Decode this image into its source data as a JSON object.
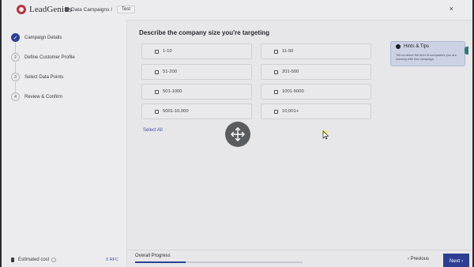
{
  "app": {
    "logo_text": "LeadGenius"
  },
  "breadcrumb": {
    "section": "Data Campaigns /",
    "current": "Test"
  },
  "close_label": "×",
  "steps": [
    {
      "number": "✓",
      "label": "Campaign Details",
      "status": "done"
    },
    {
      "number": "2",
      "label": "Define Customer Profile",
      "status": "pending"
    },
    {
      "number": "3",
      "label": "Select Data Points",
      "status": "pending"
    },
    {
      "number": "4",
      "label": "Review & Confirm",
      "status": "pending"
    }
  ],
  "estimated_cost": {
    "label": "Estimated cost",
    "value": "0 RFC"
  },
  "main": {
    "heading": "Describe the company size you're targeting",
    "options": [
      {
        "label": "1-10",
        "checked": false
      },
      {
        "label": "11-50",
        "checked": false
      },
      {
        "label": "51-200",
        "checked": false
      },
      {
        "label": "201-500",
        "checked": false
      },
      {
        "label": "501-1000",
        "checked": false
      },
      {
        "label": "1001-5000",
        "checked": false
      },
      {
        "label": "5001-10,000",
        "checked": false
      },
      {
        "label": "10,001+",
        "checked": false
      }
    ],
    "select_all": "Select All"
  },
  "tips": {
    "title": "Hints & Tips",
    "body": "Tell us about the kind of companies you are working with this campaign."
  },
  "bottom": {
    "progress_label": "Overall Progress",
    "progress": 0.3,
    "prev_label": "‹  Previous",
    "next_label": "Next  ›"
  },
  "colors": {
    "accent": "#2d3e92",
    "link": "#3d4fa8",
    "brand": "#b8343a"
  }
}
